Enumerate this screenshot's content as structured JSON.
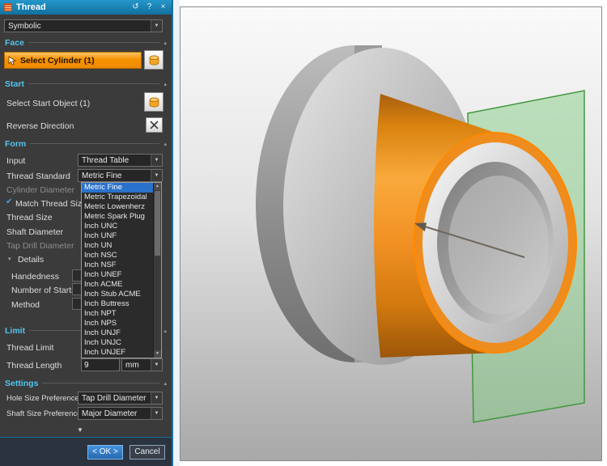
{
  "colors": {
    "accent_cyan": "#52c5ee",
    "selection_orange": "#f59300",
    "list_highlight_blue": "#2a72cc",
    "cylinder_orange": "#f08c1e",
    "plane_green": "#86cc86",
    "ok_button_blue": "#2f7fd0",
    "titlebar_teal": "#11719f"
  },
  "icons": {
    "chevron_down": "▼",
    "check": "✔",
    "triangle_down": "▾",
    "section_chevron": "▴",
    "scroll_up": "▲",
    "scroll_down": "▼",
    "more": "▼"
  },
  "titlebar": {
    "title": "Thread",
    "reset_icon": "↺",
    "help_icon": "?",
    "close_icon": "×"
  },
  "dialog": {
    "type_value": "Symbolic",
    "face": {
      "header": "Face",
      "select_cylinder": "Select Cylinder (1)"
    },
    "start": {
      "header": "Start",
      "select_start_object": "Select Start Object (1)",
      "reverse_direction": "Reverse Direction"
    },
    "form": {
      "header": "Form",
      "input_label": "Input",
      "input_value": "Thread Table",
      "thread_standard_label": "Thread Standard",
      "thread_standard_value": "Metric Fine",
      "cylinder_diameter_label": "Cylinder Diameter",
      "match_thread_size_label": "Match Thread Size to",
      "thread_size_label": "Thread Size",
      "shaft_diameter_label": "Shaft Diameter",
      "tap_drill_diameter_label": "Tap Drill Diameter",
      "details_label": "Details",
      "handedness_label": "Handedness",
      "number_of_starts_label": "Number of Starts",
      "method_label": "Method"
    },
    "thread_standard_options": [
      "Metric Fine",
      "Metric Trapezoidal",
      "Metric Lowenherz",
      "Metric Spark Plug",
      "Inch UNC",
      "Inch UNF",
      "Inch UN",
      "Inch NSC",
      "Inch NSF",
      "Inch UNEF",
      "Inch ACME",
      "Inch Stub ACME",
      "Inch Buttress",
      "Inch NPT",
      "Inch NPS",
      "Inch UNJF",
      "Inch UNJC",
      "Inch UNJEF"
    ],
    "limit": {
      "header": "Limit",
      "thread_limit_label": "Thread Limit",
      "thread_length_label": "Thread Length",
      "thread_length_value": "9",
      "thread_length_unit": "mm"
    },
    "settings": {
      "header": "Settings",
      "hole_size_label": "Hole Size Preference",
      "hole_size_value": "Tap Drill Diameter",
      "shaft_size_label": "Shaft Size Preference",
      "shaft_size_value": "Major Diameter"
    },
    "buttons": {
      "ok": "< OK >",
      "cancel": "Cancel"
    }
  }
}
